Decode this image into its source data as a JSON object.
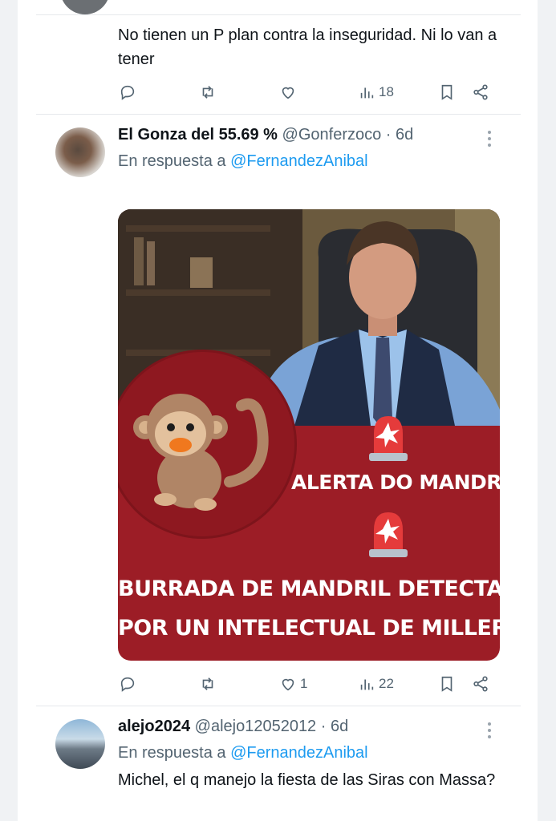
{
  "tweets": [
    {
      "text": "No tienen un P plan contra la inseguridad. Ni lo van a tener",
      "actions": {
        "replies": "",
        "retweets": "",
        "likes": "",
        "views": "18"
      }
    },
    {
      "display_name": "El Gonza del 55.69 %",
      "handle": "@Gonferzoco",
      "separator": "·",
      "time": "6d",
      "reply_prefix": "En respuesta a",
      "reply_to": "@FernandezAnibal",
      "media": {
        "line1": "ALERTA DO MANDRIL",
        "line2": "BURRADA DE MANDRIL DETECTADA",
        "line3": "POR UN INTELECTUAL DE MILLER",
        "accent": "#9c1d26"
      },
      "actions": {
        "replies": "",
        "retweets": "",
        "likes": "1",
        "views": "22"
      }
    },
    {
      "display_name": "alejo2024",
      "handle": "@alejo12052012",
      "separator": "·",
      "time": "6d",
      "reply_prefix": "En respuesta a",
      "reply_to": "@FernandezAnibal",
      "text": "Michel, el q manejo la fiesta de las Siras con Massa?"
    }
  ],
  "colors": {
    "mention": "#1d9bf0",
    "secondary": "#536471",
    "primary_text": "#0f1419"
  }
}
